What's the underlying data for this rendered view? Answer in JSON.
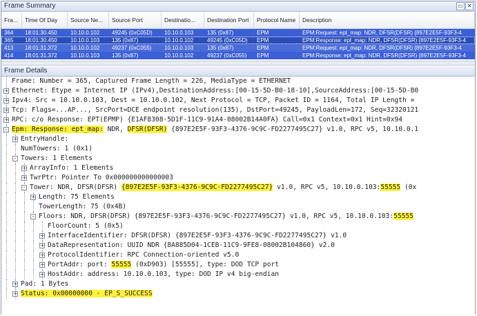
{
  "summary_pane": {
    "title": "Frame Summary",
    "columns": [
      "Fra...",
      "Time Of Day",
      "Source Ne...",
      "Source Port",
      "Destinatio...",
      "Destination Port",
      "Protocol Name",
      "Description"
    ],
    "rows": [
      {
        "frame": "364",
        "time": "18:01:30.450",
        "src": "10.10.0.102",
        "sport": "49245 (0xC05D)",
        "dst": "10.10.0.103",
        "dport": "135 (0x87)",
        "proto": "EPM",
        "desc": "EPM:Request: ept_map: NDR, DFSR(DFSR) {897E2E5F-93F3-4"
      },
      {
        "frame": "365",
        "time": "18:01:30.450",
        "src": "10.10.0.103",
        "sport": "135 (0x87)",
        "dst": "10.10.0.102",
        "dport": "49245 (0xC05D)",
        "proto": "EPM",
        "desc": "EPM:Response: ept_map: NDR, DFSR(DFSR) {897E2E5F-93F3-4"
      },
      {
        "frame": "413",
        "time": "18:01:31.372",
        "src": "10.10.0.102",
        "sport": "49237 (0xC055)",
        "dst": "10.10.0.103",
        "dport": "135 (0x87)",
        "proto": "EPM",
        "desc": "EPM:Request: ept_map: NDR, DFSR(DFSR) {897E2E5F-93F3-4"
      },
      {
        "frame": "414",
        "time": "18:01:31.372",
        "src": "10.10.0.103",
        "sport": "135 (0x87)",
        "dst": "10.10.0.102",
        "dport": "49237 (0xC055)",
        "proto": "EPM",
        "desc": "EPM:Response: ept_map: NDR, DFSR(DFSR) {897E2E5F-93F3-4"
      }
    ]
  },
  "details_pane": {
    "title": "Frame Details",
    "lines": [
      {
        "depth": 0,
        "tog": "",
        "text": "Frame: Number = 365, Captured Frame Length = 226, MediaType = ETHERNET"
      },
      {
        "depth": 0,
        "tog": "+",
        "text": "Ethernet: Etype = Internet IP (IPv4),DestinationAddress:[00-15-5D-B0-18-10],SourceAddress:[00-15-5D-B0"
      },
      {
        "depth": 0,
        "tog": "+",
        "text": "Ipv4: Src = 10.10.0.103, Dest = 10.10.0.102, Next Protocol = TCP, Packet ID = 1164, Total IP Length ="
      },
      {
        "depth": 0,
        "tog": "+",
        "text": "Tcp: Flags=...AP..., SrcPort=DCE endpoint resolution(135), DstPort=49245, PayloadLen=172, Seq=32320121"
      },
      {
        "depth": 0,
        "tog": "+",
        "text": "RPC: c/o Response: EPT(EPMP) {E1AF8308-5D1F-11C9-91A4-08002B14A0FA}  Call=0x1  Context=0x1  Hint=0x94"
      },
      {
        "depth": 0,
        "tog": "-",
        "hl_pre": "Epm: Response: ept_map:",
        "text": " NDR, ",
        "hl_mid": "DFSR(DFSR)",
        "text2": " {897E2E5F-93F3-4376-9C9C-FD2277495C27} v1.0, RPC v5, 10.10.0.1"
      },
      {
        "depth": 1,
        "tog": "+",
        "text": "EntryHandle:"
      },
      {
        "depth": 1,
        "tog": "",
        "text": "NumTowers: 1 (0x1)"
      },
      {
        "depth": 1,
        "tog": "-",
        "text": "Towers: 1 Elements"
      },
      {
        "depth": 2,
        "tog": "+",
        "text": "ArrayInfo: 1 Elements"
      },
      {
        "depth": 2,
        "tog": "+",
        "text": "TwrPtr: Pointer To 0x000000000000003"
      },
      {
        "depth": 2,
        "tog": "-",
        "text": "Tower: NDR, DFSR(DFSR) ",
        "hl_mid": "{897E2E5F-93F3-4376-9C9C-FD2277495C27}",
        "text2": " v1.0, RPC v5, 10.10.0.103:",
        "hl_end": "55555",
        "text3": " (0x"
      },
      {
        "depth": 3,
        "tog": "+",
        "text": "Length: 75 Elements"
      },
      {
        "depth": 3,
        "tog": "",
        "text": "TowerLength: 75 (0x4B)"
      },
      {
        "depth": 3,
        "tog": "-",
        "text": "Floors: NDR, DFSR(DFSR) {897E2E5F-93F3-4376-9C9C-FD2277495C27} v1.0, RPC v5, 10.10.0.103:",
        "hl_end": "55555"
      },
      {
        "depth": 4,
        "tog": "",
        "text": "FloorCount: 5 (0x5)"
      },
      {
        "depth": 4,
        "tog": "+",
        "text": "InterfaceIdentifier: DFSR(DFSR) {897E2E5F-93F3-4376-9C9C-FD2277495C27} v1.0"
      },
      {
        "depth": 4,
        "tog": "+",
        "text": "DataRepresentation: UUID NDR {8A885D04-1CEB-11C9-9FE8-08002B104860} v2.0"
      },
      {
        "depth": 4,
        "tog": "+",
        "text": "ProtocolIdentifier: RPC Connection-oriented v5.0"
      },
      {
        "depth": 4,
        "tog": "+",
        "text": "PortAddr: port: ",
        "hl_mid": "55555",
        "text2": " (0xD903) [55555], type: DOD TCP port"
      },
      {
        "depth": 4,
        "tog": "+",
        "text": "HostAddr: address: 10.10.0.103, type: DOD IP v4 big-endian"
      },
      {
        "depth": 1,
        "tog": "+",
        "text": "Pad: 1 Bytes"
      },
      {
        "depth": 1,
        "tog": "+",
        "hl_pre": "Status: 0x00000000 - EP_S_SUCCESS",
        "text": ""
      }
    ]
  }
}
